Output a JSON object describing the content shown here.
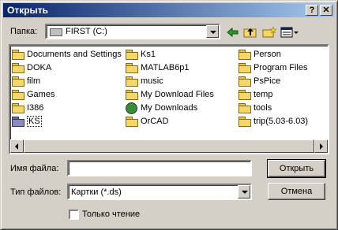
{
  "window": {
    "title": "Открыть",
    "help_glyph": "?",
    "close_glyph": "✕"
  },
  "toolbar": {
    "lookin_label": "Папка:",
    "lookin_value": "FIRST (C:)"
  },
  "files": {
    "col1": [
      "Documents and Settings",
      "DOKA",
      "film",
      "Games",
      "I386",
      "KS"
    ],
    "col2": [
      "Ks1",
      "MATLAB6p1",
      "music",
      "My Download Files",
      "My Downloads",
      "OrCAD"
    ],
    "col3": [
      "Person",
      "Program Files",
      "PsPice",
      "temp",
      "tools",
      "trip(5.03-6.03)"
    ],
    "selected": "KS"
  },
  "form": {
    "filename_label": "Имя файла:",
    "filename_value": "",
    "filetype_label": "Тип файлов:",
    "filetype_value": "Картки (*.ds)",
    "readonly_label": "Только чтение",
    "open_button": "Открыть",
    "cancel_button": "Отмена"
  }
}
